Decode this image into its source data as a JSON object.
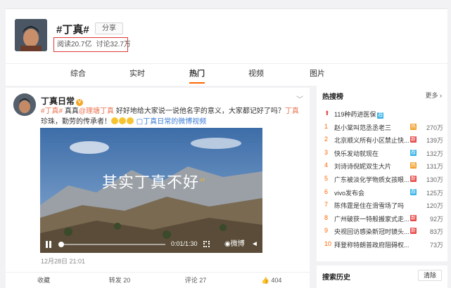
{
  "topic": {
    "title": "#丁真#",
    "share_label": "分享",
    "reads": "阅读20.7亿",
    "discussions": "讨论32.7万"
  },
  "tabs": [
    {
      "label": "综合",
      "active": false
    },
    {
      "label": "实时",
      "active": false
    },
    {
      "label": "热门",
      "active": true
    },
    {
      "label": "视频",
      "active": false
    },
    {
      "label": "图片",
      "active": false
    }
  ],
  "post": {
    "author": "丁真日常",
    "text_hashtag": "#丁真#",
    "text_a": " 真真",
    "text_mention": "@理塘丁真",
    "text_b": " 好好地给大家说一说他名字的意义，大家都记好了吗？",
    "text_hashtag2": "丁真",
    "text_c": "珍珠，勤劳的传承者！",
    "text_link": "丁真日常的微博视频",
    "video_caption_main": "其实丁真不好",
    "video_time": "0:01/1:30",
    "video_brand": "微博",
    "date": "12月28日 21:01",
    "actions": {
      "fav": "收藏",
      "repost": "转发 20",
      "comment": "评论 27",
      "like": "404"
    },
    "video_progress": 0.01
  },
  "sidebar": {
    "title": "热搜榜",
    "more": "更多 ›",
    "items": [
      {
        "rank": "",
        "text": "119种药进医保",
        "count": "",
        "tag": "荐"
      },
      {
        "rank": "1",
        "text": "赵小棠叫范丞丞老三",
        "count": "270万",
        "tag": "热"
      },
      {
        "rank": "2",
        "text": "北京顺义所有小区禁止快...",
        "count": "139万",
        "tag": "新"
      },
      {
        "rank": "3",
        "text": "快乐发动就现在",
        "count": "132万",
        "tag": "荐"
      },
      {
        "rank": "4",
        "text": "刘诗诗倪妮双生大片",
        "count": "131万",
        "tag": "热"
      },
      {
        "rank": "5",
        "text": "广东被淡化学物质女孩眼...",
        "count": "130万",
        "tag": "新"
      },
      {
        "rank": "6",
        "text": "vivo发布会",
        "count": "125万",
        "tag": "荐"
      },
      {
        "rank": "7",
        "text": "陈伟霆是住在滑雪场了吗",
        "count": "120万",
        "tag": ""
      },
      {
        "rank": "8",
        "text": "广州破获一特般搬家式走...",
        "count": "92万",
        "tag": "新"
      },
      {
        "rank": "9",
        "text": "央视回访感染新冠时镜头...",
        "count": "83万",
        "tag": "新"
      },
      {
        "rank": "10",
        "text": "拜登称特朗普政府阻碍权...",
        "count": "73万",
        "tag": ""
      }
    ],
    "history_title": "搜索历史",
    "clear_label": "清除"
  },
  "colors": {
    "accent": "#ff6600",
    "hot_tag": "#f3a02c",
    "new_tag": "#e64a4a",
    "rec_tag": "#3bb4e8",
    "link": "#3a7bd5",
    "hashtag": "#eb7350"
  }
}
